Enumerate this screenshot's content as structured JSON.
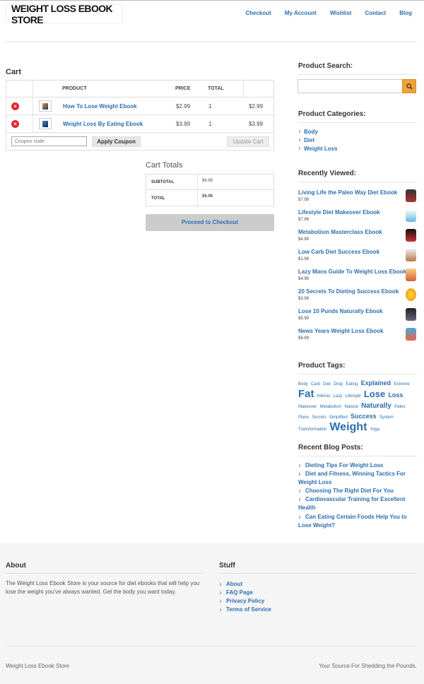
{
  "header": {
    "logo": "WEIGHT LOSS EBOOK STORE",
    "nav": [
      "Checkout",
      "My Account",
      "Wishlist",
      "Contact",
      "Blog"
    ]
  },
  "cart": {
    "title": "Cart",
    "columns": [
      "PRODUCT",
      "PRICE",
      "TOTAL"
    ],
    "rows": [
      {
        "name": "How To Lose Weight Ebook",
        "price": "$2.99",
        "qty": "1",
        "total": "$2.99"
      },
      {
        "name": "Weight Loss By Eating Ebook",
        "price": "$3.99",
        "qty": "1",
        "total": "$3.99"
      }
    ],
    "coupon_placeholder": "Coupon code",
    "apply_coupon": "Apply Coupon",
    "update_cart": "Update Cart"
  },
  "totals": {
    "title": "Cart Totals",
    "subtotal_label": "SUBTOTAL",
    "subtotal": "$6.98",
    "total_label": "TOTAL",
    "total": "$6.98",
    "checkout": "Proceed to Checkout"
  },
  "sidebar": {
    "search_title": "Product Search:",
    "categories_title": "Product Categories:",
    "categories": [
      "Body",
      "Diet",
      "Weight Loss"
    ],
    "recent_title": "Recently Viewed:",
    "recent": [
      {
        "title": "Living Life the Paleo Way Diet Ebook",
        "price": "$7.99"
      },
      {
        "title": "Lifestyle Diet Makeover Ebook",
        "price": "$7.99"
      },
      {
        "title": "Metabolism Masterclass Ebook",
        "price": "$4.99"
      },
      {
        "title": "Low Carb Diet Success Ebook",
        "price": "$1.99"
      },
      {
        "title": "Lazy Mans Guide To Weight Loss Ebook",
        "price": "$4.99"
      },
      {
        "title": "20 Secrets To Dieting Success Ebook",
        "price": "$3.99"
      },
      {
        "title": "Lose 10 Punds Naturally Ebook",
        "price": "$5.99"
      },
      {
        "title": "News Years Weight Loss Ebook",
        "price": "$6.99"
      }
    ],
    "tags_title": "Product Tags:",
    "tags": [
      {
        "t": "Body",
        "s": 6
      },
      {
        "t": "Carb",
        "s": 6
      },
      {
        "t": "Diet",
        "s": 6
      },
      {
        "t": "Drop",
        "s": 6
      },
      {
        "t": "Eating",
        "s": 6
      },
      {
        "t": "Explained",
        "s": 9
      },
      {
        "t": "Extreme",
        "s": 6
      },
      {
        "t": "Fat",
        "s": 15
      },
      {
        "t": "Inferno",
        "s": 6
      },
      {
        "t": "Lazy",
        "s": 6
      },
      {
        "t": "Lifestyle",
        "s": 6
      },
      {
        "t": "Lose",
        "s": 13
      },
      {
        "t": "Loss",
        "s": 9
      },
      {
        "t": "Makeover",
        "s": 6
      },
      {
        "t": "Metabolism",
        "s": 6
      },
      {
        "t": "Natural",
        "s": 6
      },
      {
        "t": "Naturally",
        "s": 10
      },
      {
        "t": "Paleo",
        "s": 6
      },
      {
        "t": "Plans",
        "s": 6
      },
      {
        "t": "Secrets",
        "s": 6
      },
      {
        "t": "Simplified",
        "s": 6
      },
      {
        "t": "Success",
        "s": 9
      },
      {
        "t": "System",
        "s": 6
      },
      {
        "t": "Transformation",
        "s": 6
      },
      {
        "t": "Weight",
        "s": 16
      },
      {
        "t": "Yoga",
        "s": 6
      }
    ],
    "blog_title": "Recent Blog Posts:",
    "blog": [
      "Dieting Tips For Weight Loss",
      "Diet and Fitness, Winning Tactics For Weight Loss",
      "Choosing The Right Diet For You",
      "Cardiovascular Training for Excellent Health",
      "Can Eating Certain Foods Help You to Lose Weight?"
    ]
  },
  "footer": {
    "about_title": "About",
    "about_text": "The Weight Loss Ebook Store is your source for diet ebooks that will help you lose the weight you've always wanted. Get the body you want today.",
    "stuff_title": "Stuff",
    "stuff_links": [
      "About",
      "FAQ Page",
      "Privacy Policy",
      "Terms of Service"
    ],
    "copyright": "Weight Loss Ebook Store",
    "tagline": "Your Source For Shedding the Pounds."
  },
  "colors": {
    "link": "#2a6fb0",
    "search_button": "#f2a23a",
    "remove": "#e0262f"
  }
}
